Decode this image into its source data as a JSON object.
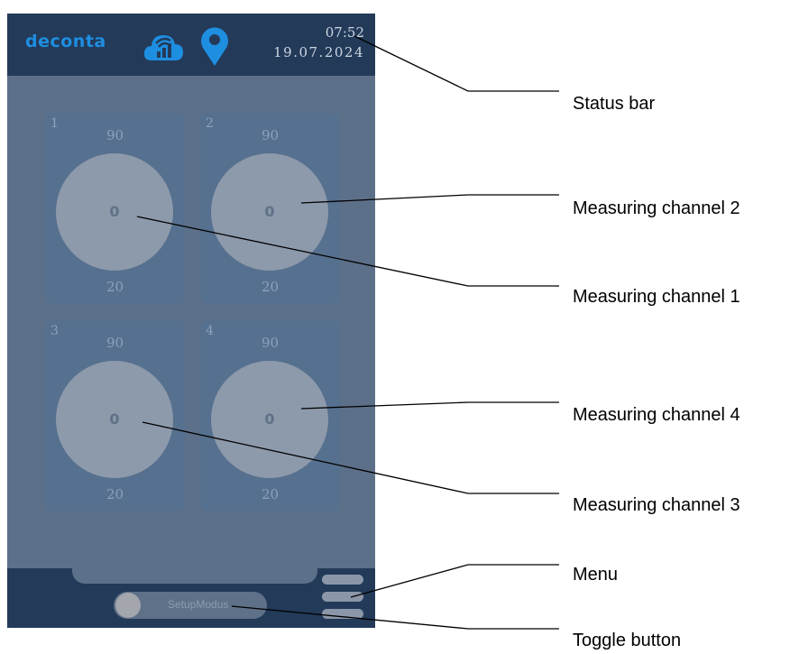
{
  "status_bar": {
    "logo": "deconta",
    "cloud_icon": "cloud-signal-icon",
    "location_icon": "map-pin-icon",
    "time": "07:52",
    "date": "19.07.2024",
    "accent": "#1e8ee0"
  },
  "channels": [
    {
      "number": "1",
      "max": "90",
      "value": "0",
      "min": "20"
    },
    {
      "number": "2",
      "max": "90",
      "value": "0",
      "min": "20"
    },
    {
      "number": "3",
      "max": "90",
      "value": "0",
      "min": "20"
    },
    {
      "number": "4",
      "max": "90",
      "value": "0",
      "min": "20"
    }
  ],
  "toggle": {
    "label": "SetupModus",
    "state": "off"
  },
  "menu": {
    "icon": "hamburger-menu-icon"
  },
  "callouts": {
    "status_bar": "Status bar",
    "channel_2": "Measuring channel 2",
    "channel_1": "Measuring channel 1",
    "channel_4": "Measuring channel 4",
    "channel_3": "Measuring channel 3",
    "menu": "Menu",
    "toggle": "Toggle button"
  }
}
